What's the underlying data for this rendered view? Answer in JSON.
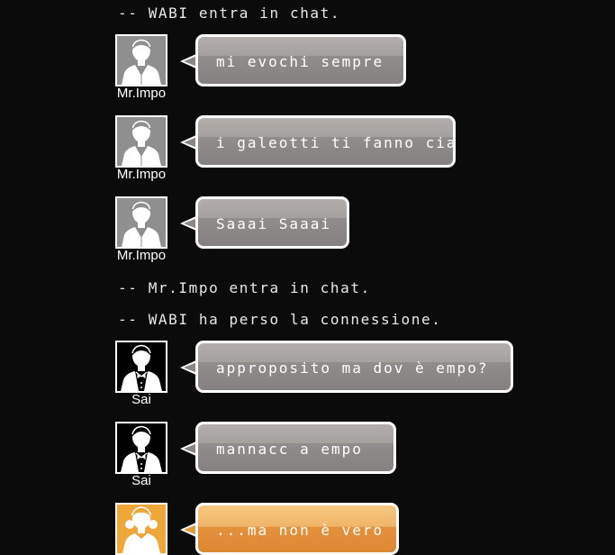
{
  "system_messages": [
    "-- WABI entra in chat.",
    "-- Mr.Impo entra in chat.",
    "-- WABI ha perso la connessione."
  ],
  "messages": [
    {
      "user": "Mr.Impo",
      "avatar_icon": "man-suit-icon",
      "text": "mi evochi sempre"
    },
    {
      "user": "Mr.Impo",
      "avatar_icon": "man-suit-icon",
      "text": "i galeotti ti fanno ciao"
    },
    {
      "user": "Mr.Impo",
      "avatar_icon": "man-suit-icon",
      "text": "Saaai Saaai"
    },
    {
      "user": "Sai",
      "avatar_icon": "man-bowtie-icon",
      "text": "approposito ma dov è empo?"
    },
    {
      "user": "Sai",
      "avatar_icon": "man-bowtie-icon",
      "text": "mannacc a empo"
    },
    {
      "user": "",
      "avatar_icon": "woman-icon",
      "text": "...ma non è vero"
    }
  ],
  "colors": {
    "background": "#0b0b0b",
    "bubble_gray": "#8b8585",
    "bubble_orange": "#e39a45",
    "avatar_gray": "#8f8f8f",
    "avatar_orange": "#f0a73a"
  }
}
